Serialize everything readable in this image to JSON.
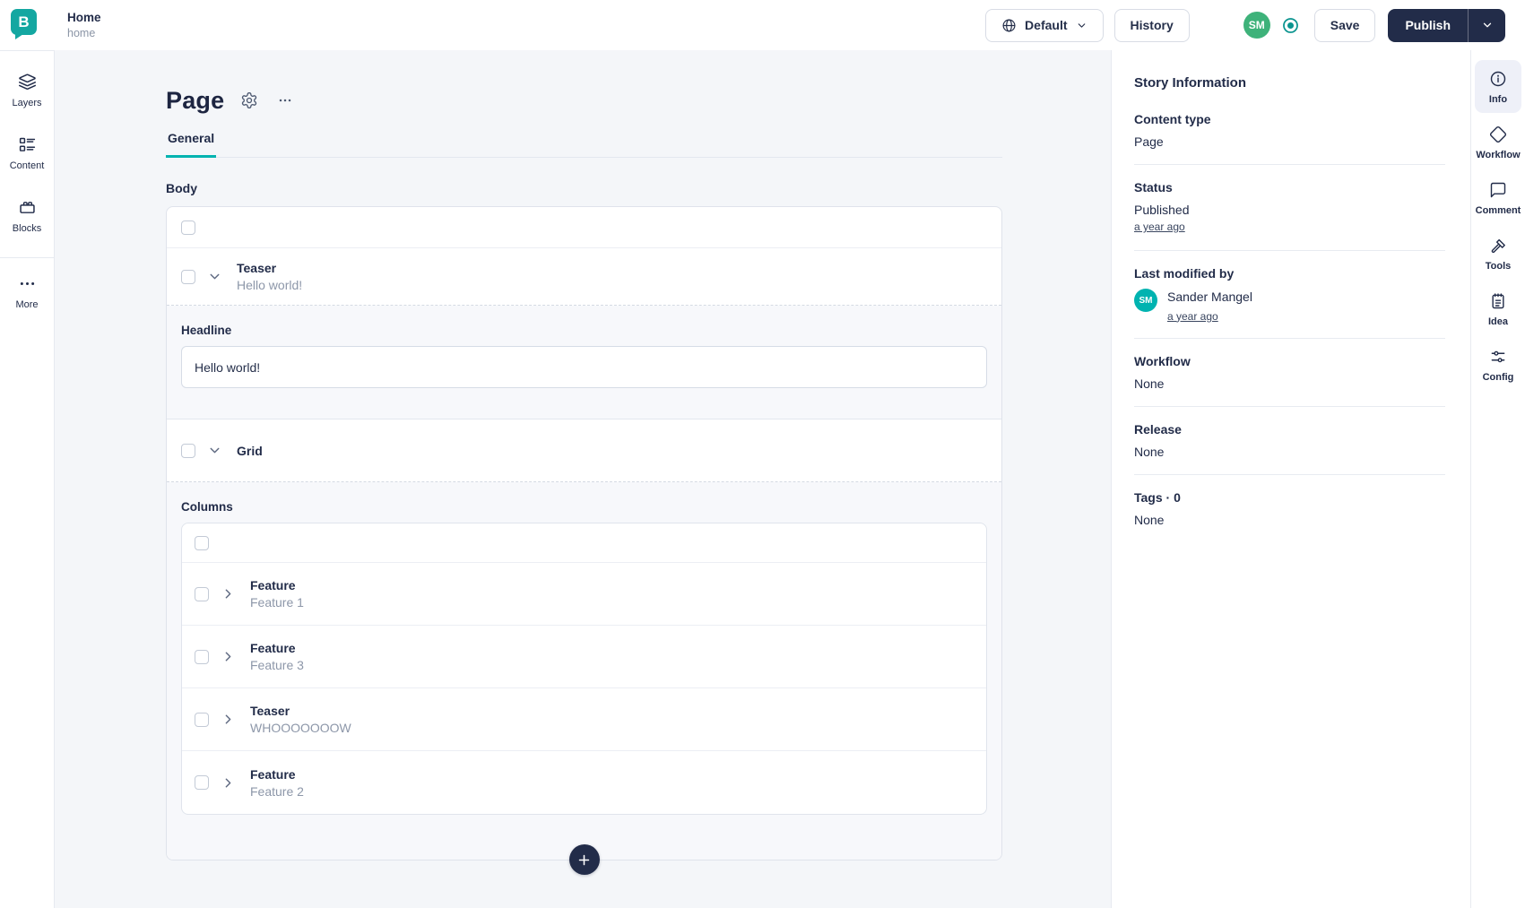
{
  "topbar": {
    "logo_letter": "B",
    "breadcrumb": {
      "title": "Home",
      "slug": "home"
    },
    "language_button": "Default",
    "history_button": "History",
    "avatar_initials": "SM",
    "save_button": "Save",
    "publish_button": "Publish"
  },
  "left_sidebar": {
    "items": [
      {
        "label": "Layers"
      },
      {
        "label": "Content"
      },
      {
        "label": "Blocks"
      },
      {
        "label": "More"
      }
    ]
  },
  "editor": {
    "title": "Page",
    "tabs": [
      {
        "label": "General",
        "active": true
      }
    ],
    "body_field_label": "Body",
    "teaser_block": {
      "name": "Teaser",
      "preview": "Hello world!"
    },
    "headline_field": {
      "label": "Headline",
      "value": "Hello world!"
    },
    "grid_block": {
      "name": "Grid"
    },
    "columns_field_label": "Columns",
    "column_blocks": [
      {
        "name": "Feature",
        "preview": "Feature 1"
      },
      {
        "name": "Feature",
        "preview": "Feature 3"
      },
      {
        "name": "Teaser",
        "preview": "WHOOOOOOOW"
      },
      {
        "name": "Feature",
        "preview": "Feature 2"
      }
    ]
  },
  "story_info": {
    "title": "Story Information",
    "content_type": {
      "label": "Content type",
      "value": "Page"
    },
    "status": {
      "label": "Status",
      "value": "Published",
      "time": "a year ago"
    },
    "last_modified": {
      "label": "Last modified by",
      "avatar_initials": "SM",
      "name": "Sander Mangel",
      "time": "a year ago"
    },
    "workflow": {
      "label": "Workflow",
      "value": "None"
    },
    "release": {
      "label": "Release",
      "value": "None"
    },
    "tags": {
      "label": "Tags · 0",
      "value": "None"
    }
  },
  "right_sidebar": {
    "items": [
      {
        "label": "Info",
        "active": true
      },
      {
        "label": "Workflow"
      },
      {
        "label": "Comment"
      },
      {
        "label": "Tools"
      },
      {
        "label": "Idea"
      },
      {
        "label": "Config"
      }
    ]
  },
  "colors": {
    "brand_teal": "#00b3b0",
    "logo_teal": "#14a7a1",
    "navy": "#222c49",
    "avatar_green": "#3eb27a",
    "active_tab_underline": "#00b3b0",
    "info_active_bg": "#eef0f8",
    "main_background": "#f4f6f9"
  }
}
